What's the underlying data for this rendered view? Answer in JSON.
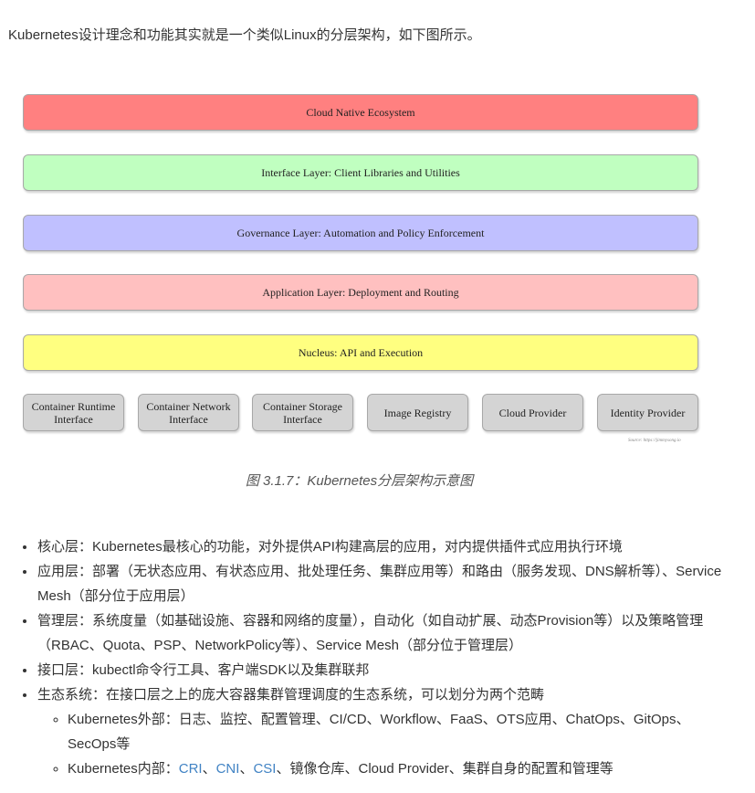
{
  "intro": "Kubernetes设计理念和功能其实就是一个类似Linux的分层架构，如下图所示。",
  "diagram": {
    "layers": [
      {
        "label": "Cloud Native Ecosystem",
        "color": "#ff8080"
      },
      {
        "label": "Interface Layer: Client Libraries and Utilities",
        "color": "#c0ffc0"
      },
      {
        "label": "Governance Layer: Automation and Policy Enforcement",
        "color": "#c0c0ff"
      },
      {
        "label": "Application Layer: Deployment and Routing",
        "color": "#ffc0c0"
      },
      {
        "label": "Nucleus: API and Execution",
        "color": "#ffff80"
      }
    ],
    "infra": [
      {
        "line1": "Container Runtime",
        "line2": "Interface"
      },
      {
        "line1": "Container Network",
        "line2": "Interface"
      },
      {
        "line1": "Container Storage",
        "line2": "Interface"
      },
      {
        "line1": "Image Registry",
        "line2": ""
      },
      {
        "line1": "Cloud Provider",
        "line2": ""
      },
      {
        "line1": "Identity Provider",
        "line2": ""
      }
    ],
    "source": "Source: https://jimmysong.io"
  },
  "caption": "图 3.1.7：Kubernetes分层架构示意图",
  "bullets": {
    "core": "核心层：Kubernetes最核心的功能，对外提供API构建高层的应用，对内提供插件式应用执行环境",
    "app": "应用层：部署（无状态应用、有状态应用、批处理任务、集群应用等）和路由（服务发现、DNS解析等）、Service Mesh（部分位于应用层）",
    "gov": "管理层：系统度量（如基础设施、容器和网络的度量），自动化（如自动扩展、动态Provision等）以及策略管理（RBAC、Quota、PSP、NetworkPolicy等）、Service Mesh（部分位于管理层）",
    "iface": "接口层：kubectl命令行工具、客户端SDK以及集群联邦",
    "eco": "生态系统：在接口层之上的庞大容器集群管理调度的生态系统，可以划分为两个范畴",
    "eco_external": "Kubernetes外部：日志、监控、配置管理、CI/CD、Workflow、FaaS、OTS应用、ChatOps、GitOps、SecOps等",
    "eco_internal_prefix": "Kubernetes内部：",
    "eco_internal_links": [
      "CRI",
      "CNI",
      "CSI"
    ],
    "sep": "、",
    "eco_internal_suffix": "镜像仓库、Cloud Provider、集群自身的配置和管理等"
  }
}
